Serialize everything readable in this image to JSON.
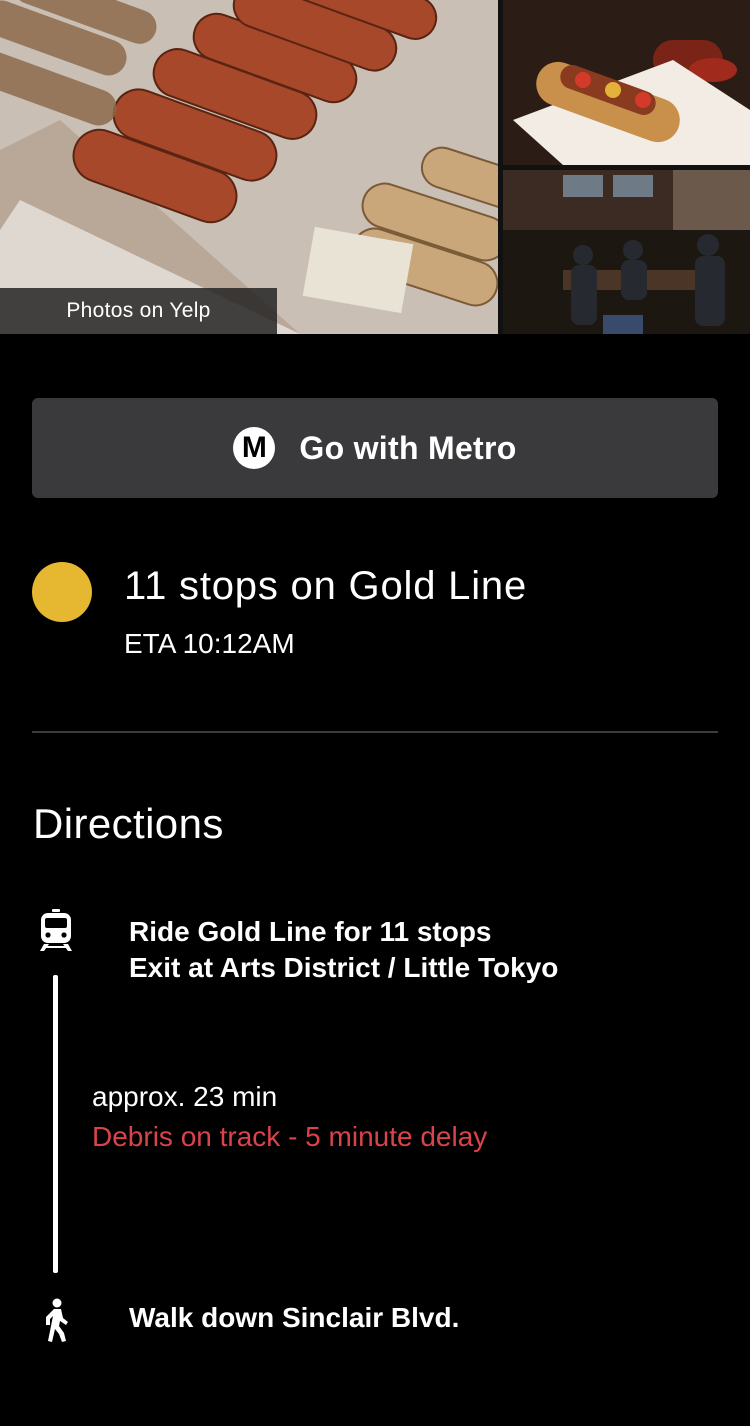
{
  "gallery": {
    "label": "Photos on Yelp"
  },
  "metro_button": {
    "logo_letter": "M",
    "label": "Go with Metro"
  },
  "summary": {
    "title": "11 stops on Gold Line",
    "eta": "ETA 10:12AM",
    "line_color": "#e6b730"
  },
  "directions": {
    "heading": "Directions",
    "steps": [
      {
        "icon": "train-icon",
        "line1": "Ride Gold Line for 11 stops",
        "line2": "Exit at Arts District / Little Tokyo",
        "duration": "approx. 23 min",
        "alert": "Debris on track - 5 minute delay",
        "alert_color": "#d9434a"
      },
      {
        "icon": "walk-icon",
        "line1": "Walk down Sinclair Blvd."
      }
    ]
  }
}
